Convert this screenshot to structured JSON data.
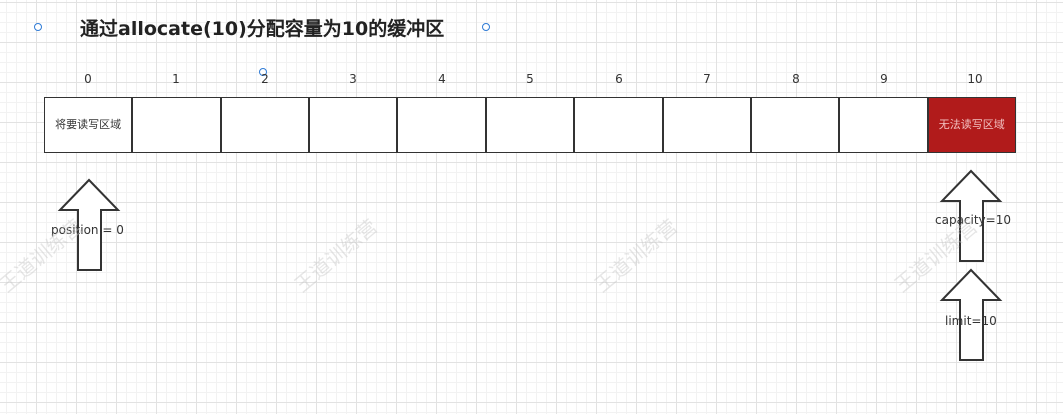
{
  "title": "通过allocate(10)分配容量为10的缓冲区",
  "indices": [
    "0",
    "1",
    "2",
    "3",
    "4",
    "5",
    "6",
    "7",
    "8",
    "9",
    "10"
  ],
  "cells": [
    "将要读写区域",
    "",
    "",
    "",
    "",
    "",
    "",
    "",
    "",
    "",
    "无法读写区域"
  ],
  "colors": {
    "limit_cell": "#b11b1b",
    "handle": "#2f7bd6"
  },
  "labels": {
    "position": "position  = 0",
    "capacity": "capacity=10",
    "limit": "limit=10"
  },
  "watermark": "王道训练营"
}
